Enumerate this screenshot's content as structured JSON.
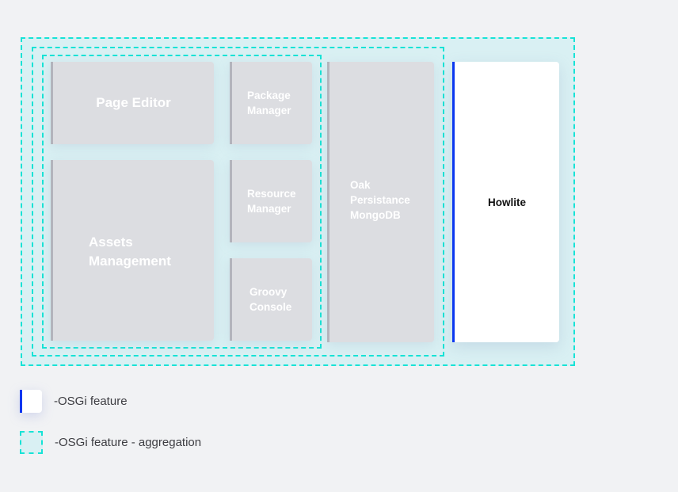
{
  "colors": {
    "background": "#f1f2f4",
    "aggregation_fill": "#d9f0f3",
    "aggregation_border": "#17e3d6",
    "feature_box": "#dcdde1",
    "feature_accent": "#0a37f0",
    "highlight_box": "#ffffff"
  },
  "diagram": {
    "aggregations": [
      "outer-aggregation",
      "middle-aggregation",
      "inner-aggregation"
    ],
    "features": {
      "page_editor": "Page Editor",
      "assets_management": "Assets\nManagement",
      "package_manager": "Package\nManager",
      "resource_manager": "Resource\nManager",
      "groovy_console": "Groovy\nConsole",
      "oak_persistance": "Oak\nPersistance\nMongoDB",
      "howlite": "Howlite"
    }
  },
  "legend": {
    "feature_label": "-OSGi feature",
    "aggregation_label": "-OSGi feature - aggregation"
  }
}
